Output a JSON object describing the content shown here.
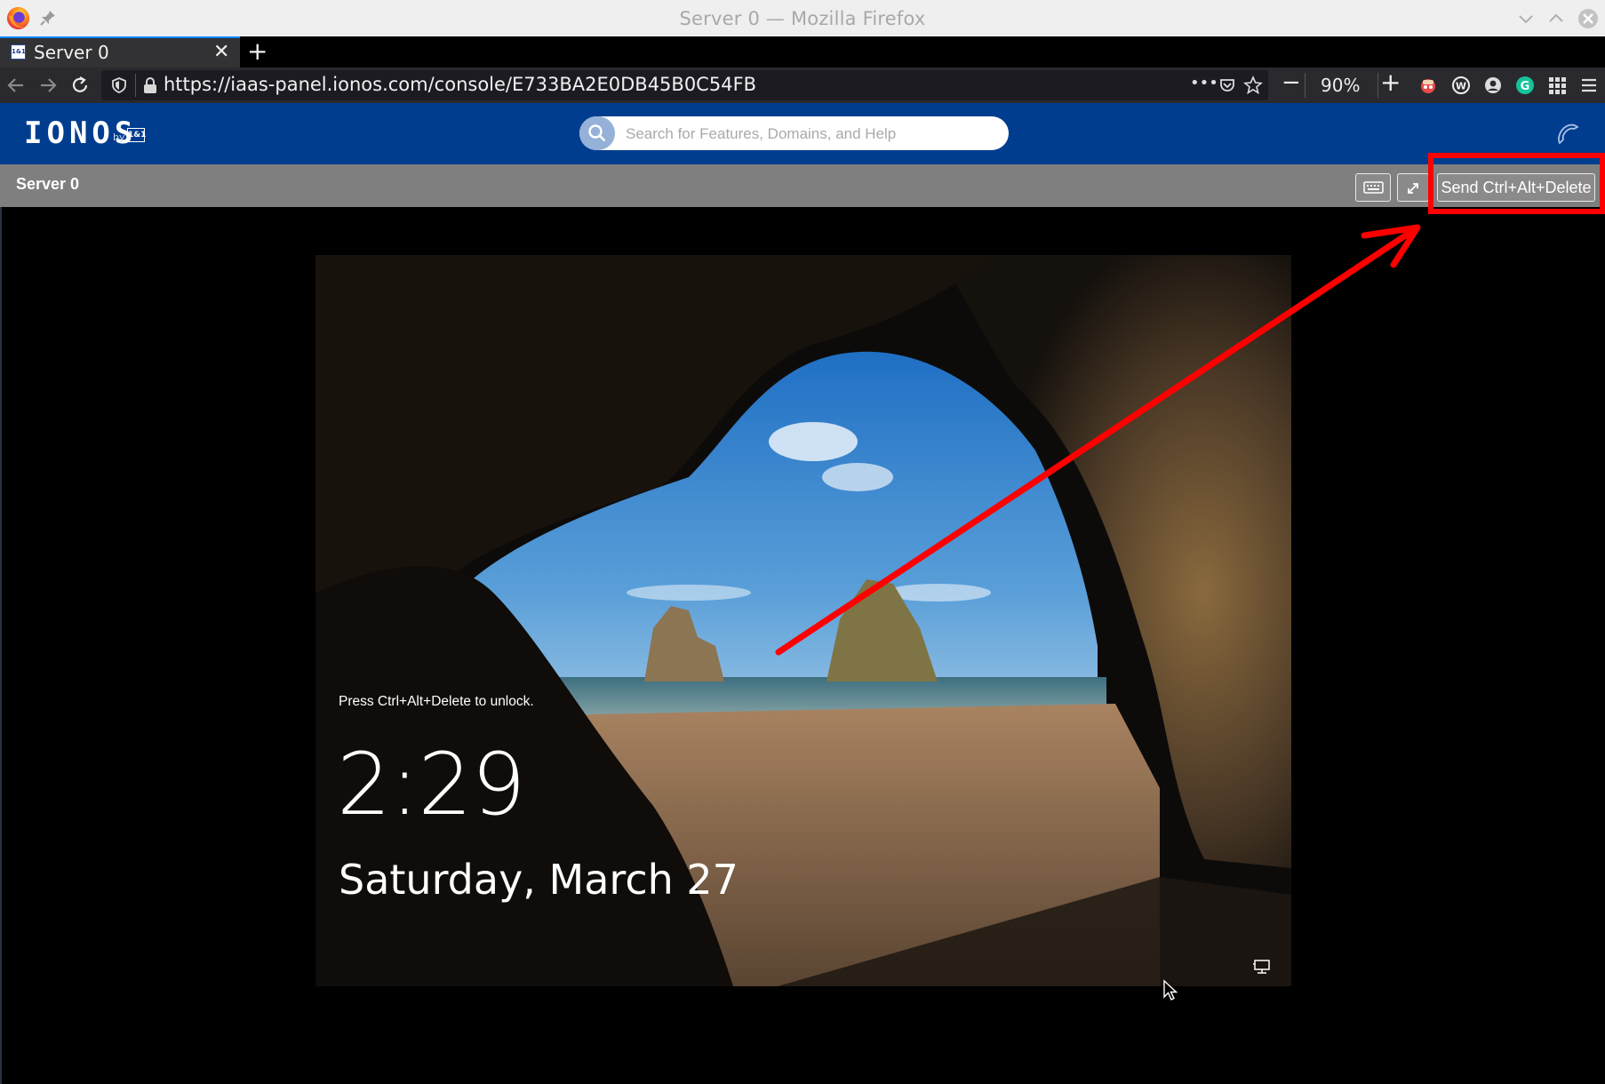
{
  "window": {
    "title": "Server 0 — Mozilla Firefox"
  },
  "tab": {
    "label": "Server 0",
    "favicon_text": "1&1",
    "close": "✕",
    "new": "+"
  },
  "navbar": {
    "url": "https://iaas-panel.ionos.com/console/E733BA2E0DB45B0C54FB",
    "zoom": "90%",
    "zoom_out": "−",
    "zoom_in": "+",
    "more": "•••"
  },
  "ionos": {
    "logo": "IONOS",
    "by": "by",
    "badge": "1&1",
    "search_placeholder": "Search for Features, Domains, and Help"
  },
  "console": {
    "title": "Server 0",
    "send_cad_label": "Send Ctrl+Alt+Delete"
  },
  "lockscreen": {
    "message": "Press Ctrl+Alt+Delete to unlock.",
    "time": "2:29",
    "date": "Saturday, March 27"
  },
  "colors": {
    "ionos_blue": "#003d8f",
    "console_gray": "#7f7f7f",
    "annotation_red": "#ff0000",
    "tab_accent": "#0a84ff"
  },
  "icons": {
    "browser": "firefox-icon",
    "pin": "pin-icon",
    "back": "back-arrow-icon",
    "forward": "forward-arrow-icon",
    "reload": "reload-icon",
    "shield": "shield-icon",
    "lock": "lock-icon",
    "pocket": "pocket-icon",
    "bookmark": "star-icon",
    "search": "search-icon",
    "phone": "phone-icon",
    "keyboard": "keyboard-icon",
    "fullscreen": "expand-icon",
    "network": "network-icon"
  }
}
